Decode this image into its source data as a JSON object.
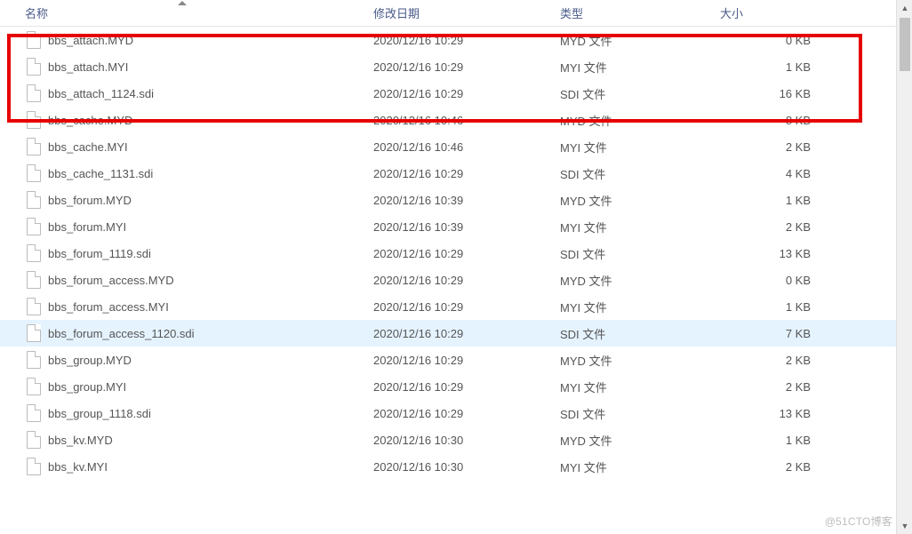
{
  "columns": {
    "name": "名称",
    "date": "修改日期",
    "type": "类型",
    "size": "大小"
  },
  "files": [
    {
      "name": "bbs_attach.MYD",
      "date": "2020/12/16 10:29",
      "type": "MYD 文件",
      "size": "0 KB",
      "selected": false
    },
    {
      "name": "bbs_attach.MYI",
      "date": "2020/12/16 10:29",
      "type": "MYI 文件",
      "size": "1 KB",
      "selected": false
    },
    {
      "name": "bbs_attach_1124.sdi",
      "date": "2020/12/16 10:29",
      "type": "SDI 文件",
      "size": "16 KB",
      "selected": false
    },
    {
      "name": "bbs_cache.MYD",
      "date": "2020/12/16 10:46",
      "type": "MYD 文件",
      "size": "8 KB",
      "selected": false
    },
    {
      "name": "bbs_cache.MYI",
      "date": "2020/12/16 10:46",
      "type": "MYI 文件",
      "size": "2 KB",
      "selected": false
    },
    {
      "name": "bbs_cache_1131.sdi",
      "date": "2020/12/16 10:29",
      "type": "SDI 文件",
      "size": "4 KB",
      "selected": false
    },
    {
      "name": "bbs_forum.MYD",
      "date": "2020/12/16 10:39",
      "type": "MYD 文件",
      "size": "1 KB",
      "selected": false
    },
    {
      "name": "bbs_forum.MYI",
      "date": "2020/12/16 10:39",
      "type": "MYI 文件",
      "size": "2 KB",
      "selected": false
    },
    {
      "name": "bbs_forum_1119.sdi",
      "date": "2020/12/16 10:29",
      "type": "SDI 文件",
      "size": "13 KB",
      "selected": false
    },
    {
      "name": "bbs_forum_access.MYD",
      "date": "2020/12/16 10:29",
      "type": "MYD 文件",
      "size": "0 KB",
      "selected": false
    },
    {
      "name": "bbs_forum_access.MYI",
      "date": "2020/12/16 10:29",
      "type": "MYI 文件",
      "size": "1 KB",
      "selected": false
    },
    {
      "name": "bbs_forum_access_1120.sdi",
      "date": "2020/12/16 10:29",
      "type": "SDI 文件",
      "size": "7 KB",
      "selected": true
    },
    {
      "name": "bbs_group.MYD",
      "date": "2020/12/16 10:29",
      "type": "MYD 文件",
      "size": "2 KB",
      "selected": false
    },
    {
      "name": "bbs_group.MYI",
      "date": "2020/12/16 10:29",
      "type": "MYI 文件",
      "size": "2 KB",
      "selected": false
    },
    {
      "name": "bbs_group_1118.sdi",
      "date": "2020/12/16 10:29",
      "type": "SDI 文件",
      "size": "13 KB",
      "selected": false
    },
    {
      "name": "bbs_kv.MYD",
      "date": "2020/12/16 10:30",
      "type": "MYD 文件",
      "size": "1 KB",
      "selected": false
    },
    {
      "name": "bbs_kv.MYI",
      "date": "2020/12/16 10:30",
      "type": "MYI 文件",
      "size": "2 KB",
      "selected": false
    }
  ],
  "watermark": "@51CTO博客"
}
